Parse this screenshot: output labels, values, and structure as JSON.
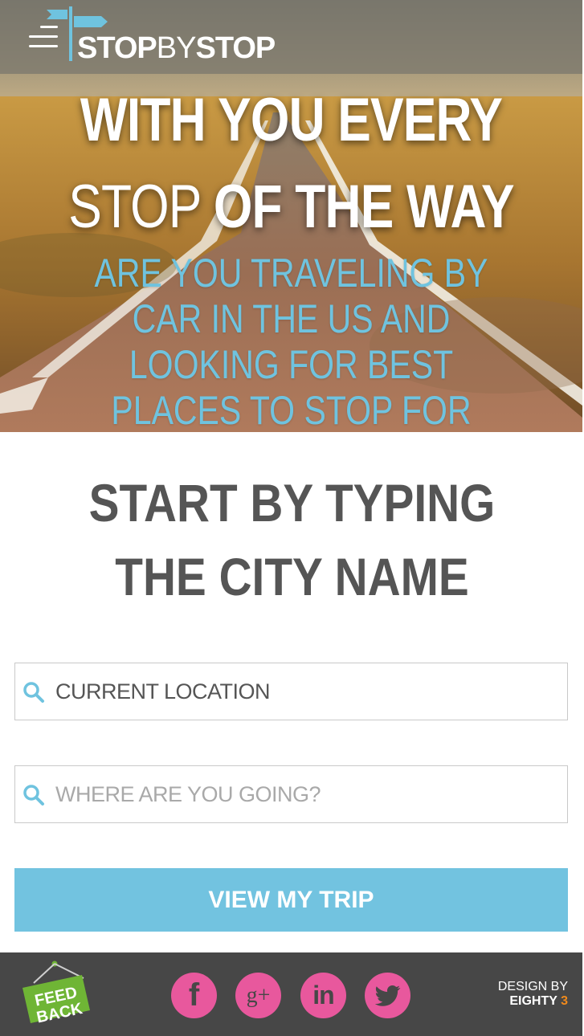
{
  "header": {
    "logo_bold_1": "STOP",
    "logo_thin": "BY",
    "logo_bold_2": "STOP",
    "menu_icon": "hamburger-menu-icon"
  },
  "hero": {
    "line1": "WITH YOU EVERY",
    "line2_thin": "STOP",
    "line2_bold": "OF THE WAY",
    "subtitle": "ARE YOU TRAVELING BY CAR IN THE US AND LOOKING FOR BEST PLACES TO STOP FOR FOOD OR GAS?"
  },
  "main": {
    "headline": "START BY TYPING THE CITY NAME",
    "from_placeholder": "CURRENT LOCATION",
    "to_placeholder": "WHERE ARE YOU GOING?",
    "button_label": "VIEW MY TRIP"
  },
  "footer": {
    "feedback_line1": "FEED",
    "feedback_line2": "BACK",
    "social": [
      {
        "icon": "facebook-icon",
        "glyph": "f"
      },
      {
        "icon": "google-plus-icon",
        "glyph": "g+"
      },
      {
        "icon": "linkedin-icon",
        "glyph": "in"
      },
      {
        "icon": "twitter-icon",
        "glyph": "bird"
      }
    ],
    "credit_line1": "DESIGN BY",
    "credit_name": "EIGHTY",
    "credit_num": "3"
  },
  "colors": {
    "accent_blue": "#72c3e0",
    "social_pink": "#e8589d",
    "feedback_green": "#6fb535",
    "footer_bg": "#474747",
    "headline_gray": "#555555",
    "credit_orange": "#f08a1c"
  }
}
